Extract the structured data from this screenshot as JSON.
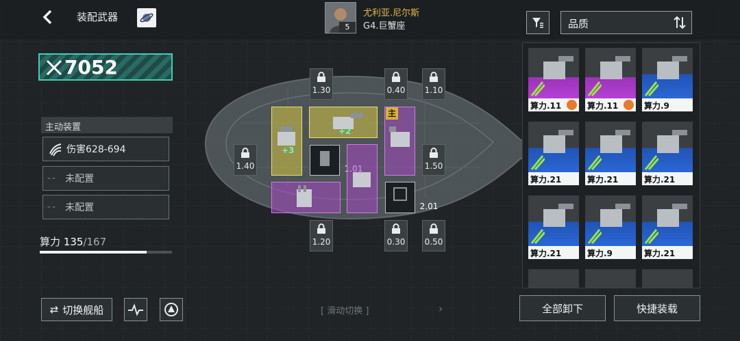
{
  "header": {
    "title": "装配武器",
    "back_icon": "back-icon",
    "planet_icon": "planet-icon"
  },
  "combat_power": {
    "value": "7052",
    "icon": "crossed-swords-icon",
    "accent": "#3fd0b5"
  },
  "commander": {
    "name": "尤利亚.尼尔斯",
    "level": "5",
    "ship": "G4.巨蟹座"
  },
  "active_equipment": {
    "title": "主动装置",
    "rows": [
      {
        "icon": "claw-icon",
        "text": "伤害628-694"
      },
      {
        "icon": "",
        "text": "未配置"
      },
      {
        "icon": "",
        "text": "未配置"
      }
    ]
  },
  "capacity": {
    "label": "算力",
    "current": "135",
    "max": "/167",
    "fraction": 0.808
  },
  "locked_slots": [
    "1.30",
    "0.40",
    "1.10",
    "1.40",
    "1.50",
    "1.20",
    "0.30",
    "0.50"
  ],
  "installed_slots": [
    {
      "quality": "gold",
      "bonus": "+3"
    },
    {
      "quality": "gold",
      "bonus": "+2"
    },
    {
      "quality": "purple",
      "bonus": "",
      "badge": "主"
    },
    {
      "quality": "empty-special",
      "value": "1.01"
    },
    {
      "quality": "purple",
      "bonus": ""
    },
    {
      "quality": "purple",
      "bonus": ""
    },
    {
      "quality": "empty-special",
      "value": "2.01"
    }
  ],
  "bottom_left": {
    "swap_label": "切换舰船",
    "swap_icon": "swap-icon",
    "icon2": "pulse-icon",
    "icon3": "fleet-icon"
  },
  "slide_hint": "[ 滑动切换 ]",
  "sort": {
    "filter_icon": "filter-icon",
    "label": "品质",
    "order_icon": "sort-order-icon"
  },
  "inventory": [
    {
      "quality": "purple",
      "label": "算力.11",
      "gear": true
    },
    {
      "quality": "purple",
      "label": "算力.11",
      "gear": true
    },
    {
      "quality": "blue",
      "label": "算力.9",
      "gear": false
    },
    {
      "quality": "blue",
      "label": "算力.21",
      "gear": false
    },
    {
      "quality": "blue",
      "label": "算力.21",
      "gear": false
    },
    {
      "quality": "blue",
      "label": "算力.21",
      "gear": false
    },
    {
      "quality": "blue",
      "label": "算力.21",
      "gear": false
    },
    {
      "quality": "blue",
      "label": "算力.9",
      "gear": false
    },
    {
      "quality": "blue",
      "label": "算力.21",
      "gear": false
    }
  ],
  "actions": {
    "unload_all": "全部卸下",
    "quick_equip": "快捷装载"
  }
}
